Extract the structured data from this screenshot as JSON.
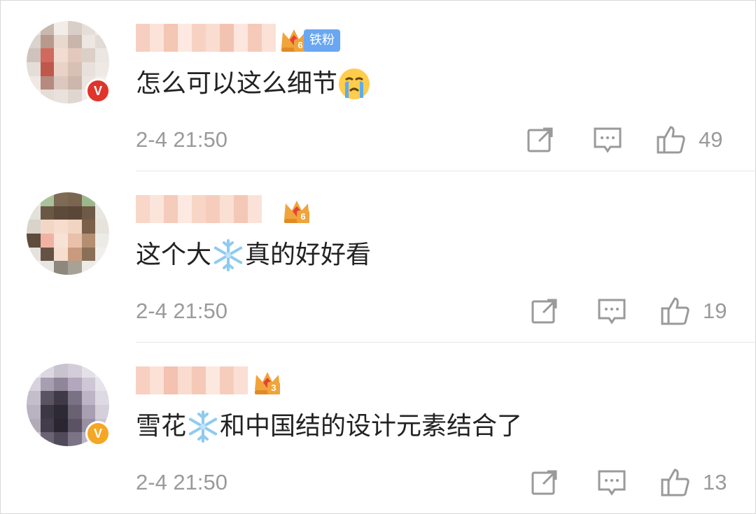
{
  "comments": [
    {
      "level": "6",
      "fan_tag": "铁粉",
      "text_parts": [
        "怎么可以这么细节"
      ],
      "emoji": "crying-face",
      "time": "2-4 21:50",
      "likes": "49",
      "verified_color": "#e0352b"
    },
    {
      "level": "6",
      "text_parts": [
        "这个大",
        "真的好好看"
      ],
      "emoji": "snowflake",
      "time": "2-4 21:50",
      "likes": "19"
    },
    {
      "level": "3",
      "text_parts": [
        "雪花",
        "和中国结的设计元素结合了"
      ],
      "emoji": "snowflake",
      "time": "2-4 21:50",
      "likes": "13",
      "verified_color": "#f5a623"
    }
  ],
  "colors": {
    "text": "#222222",
    "meta": "#9a9a9a",
    "fan_tag_bg": "#6aa7f2",
    "crown": "#f0a43a"
  }
}
